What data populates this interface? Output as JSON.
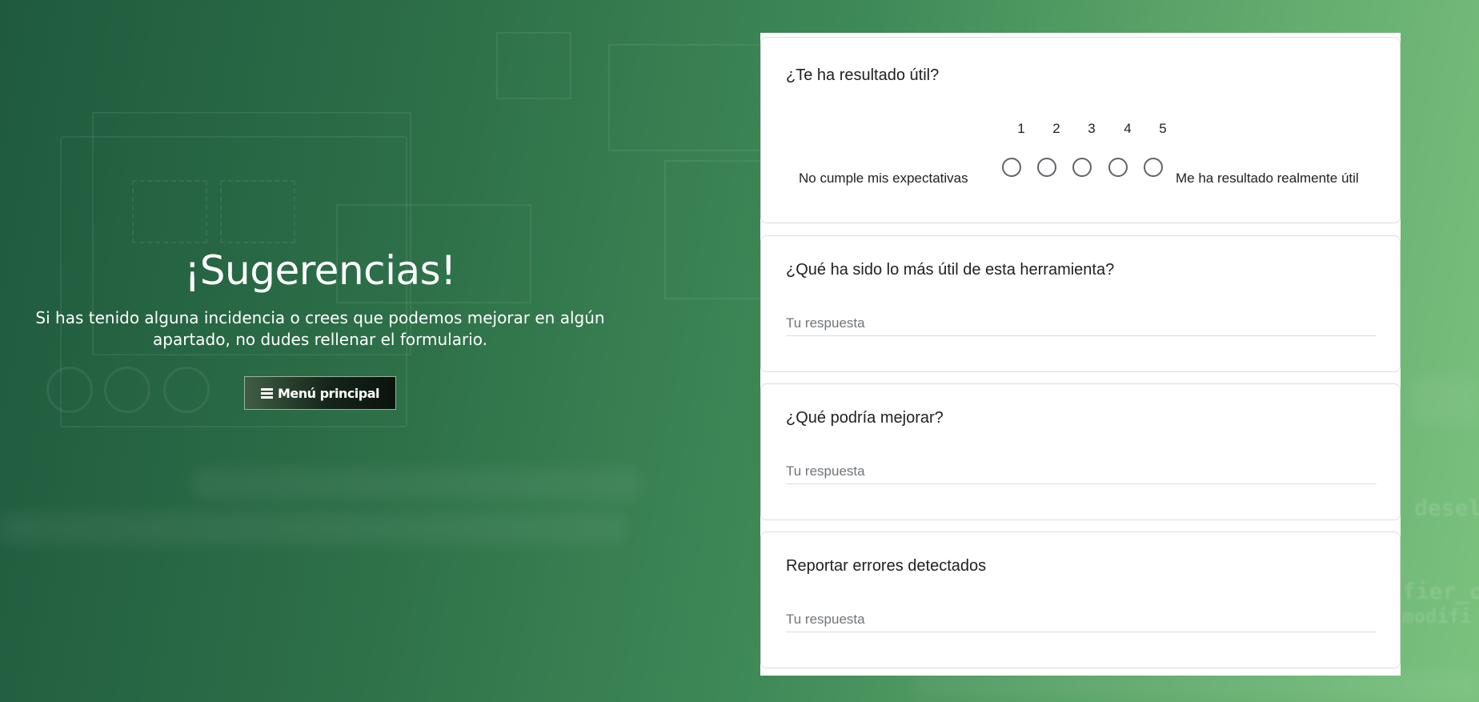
{
  "hero": {
    "title": "¡Sugerencias!",
    "description": "Si has tenido alguna incidencia o crees que podemos mejorar en algún apartado, no dudes rellenar el formulario.",
    "menu_button_label": "Menú principal",
    "menu_icon": "bars-icon"
  },
  "background_code": [
    "desel",
    "fier_o",
    "modifi"
  ],
  "form": {
    "rating": {
      "question": "¿Te ha resultado útil?",
      "scale": [
        "1",
        "2",
        "3",
        "4",
        "5"
      ],
      "low_label": "No cumple mis expectativas",
      "high_label": "Me ha resultado realmente útil"
    },
    "questions": [
      {
        "title": "¿Qué ha sido lo más útil de esta herramienta?",
        "placeholder": "Tu respuesta",
        "value": ""
      },
      {
        "title": "¿Qué podría mejorar?",
        "placeholder": "Tu respuesta",
        "value": ""
      },
      {
        "title": "Reportar errores detectados",
        "placeholder": "Tu respuesta",
        "value": ""
      }
    ]
  },
  "colors": {
    "background_start": "#1f5a3e",
    "background_end": "#7bc27e",
    "button_bg": "#15251a",
    "card_border": "#dadce0"
  }
}
